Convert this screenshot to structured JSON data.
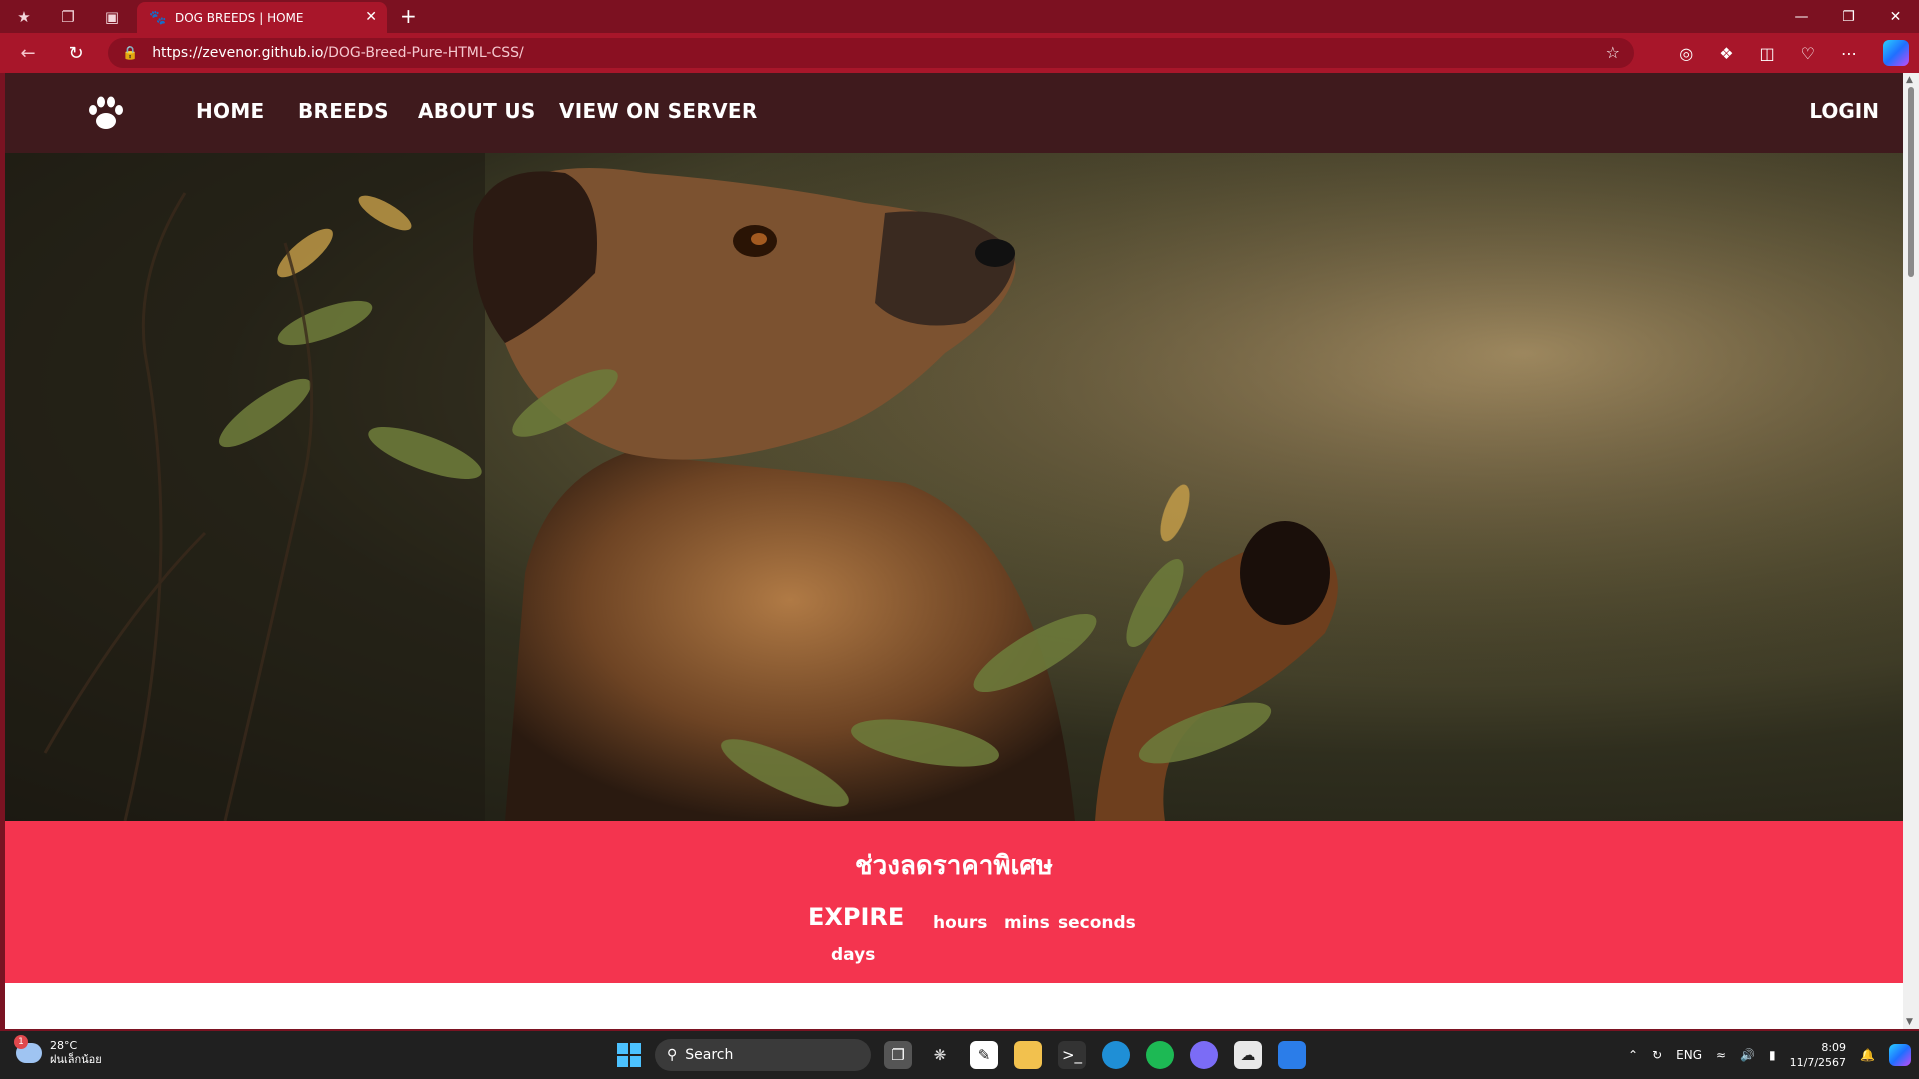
{
  "browser": {
    "tab_title": "DOG BREEDS | HOME",
    "url_host": "https://zevenor.github.io",
    "url_path": "/DOG-Breed-Pure-HTML-CSS/",
    "icons": [
      "profile-icon",
      "workspaces-icon",
      "tab-actions-icon",
      "paw-favicon-icon",
      "close-tab-icon",
      "new-tab-icon",
      "back-icon",
      "refresh-icon",
      "lock-icon",
      "favorite-star-icon",
      "extensions-icon",
      "split-screen-icon",
      "favorites-icon",
      "more-icon",
      "copilot-icon"
    ]
  },
  "site": {
    "nav": [
      "HOME",
      "BREEDS",
      "ABOUT US",
      "VIEW ON SERVER"
    ],
    "login": "LOGIN",
    "accent": "#f4344f",
    "nav_bg": "#3f1a1d"
  },
  "promo": {
    "title": "ช่วงลดราคาพิเศษ",
    "expire": "EXPIRE",
    "hours": "hours",
    "mins": "mins",
    "seconds": "seconds",
    "days": "days"
  },
  "taskbar": {
    "weather_temp": "28°C",
    "weather_desc": "ฝนเล็กน้อย",
    "weather_badge": "1",
    "search": "Search",
    "lang": "ENG",
    "time": "8:09",
    "date": "11/7/2567"
  }
}
